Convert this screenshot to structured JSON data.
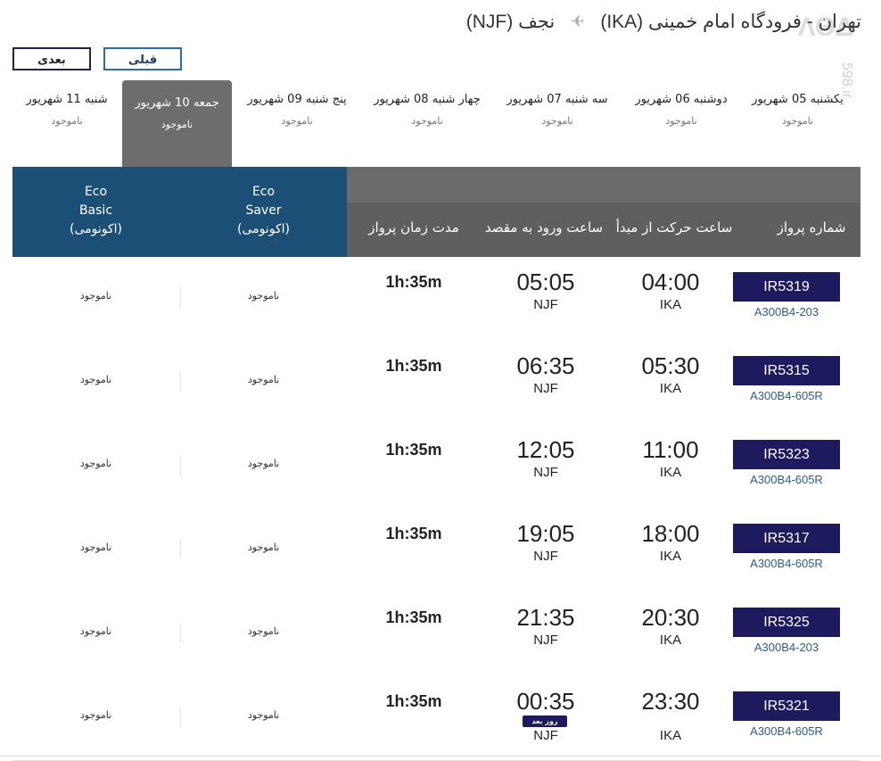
{
  "route": {
    "origin": "تهران - فرودگاه امام خمینی (IKA)",
    "destination": "نجف (NJF)",
    "plane_icon": "✈"
  },
  "watermark": {
    "main": "ΛΘΔ",
    "vertical": "598.ir"
  },
  "nav": {
    "prev_label": "قبلی",
    "next_label": "بعدی"
  },
  "days": [
    {
      "label": "یکشنبه 05 شهریور",
      "status": "ناموجود",
      "active": false
    },
    {
      "label": "دوشنبه 06 شهریور",
      "status": "ناموجود",
      "active": false
    },
    {
      "label": "سه شنبه 07 شهریور",
      "status": "ناموجود",
      "active": false
    },
    {
      "label": "چهار شنبه 08 شهریور",
      "status": "ناموجود",
      "active": false
    },
    {
      "label": "پنج شنبه 09 شهریور",
      "status": "ناموجود",
      "active": false
    },
    {
      "label": "جمعه 10 شهریور",
      "status": "ناموجود",
      "active": true
    },
    {
      "label": "شنبه 11 شهریور",
      "status": "ناموجود",
      "active": false
    }
  ],
  "columns": {
    "flight_no": "شماره پرواز",
    "departure": "ساعت حرکت از مبدأ",
    "arrival": "ساعت ورود به مقصد",
    "duration": "مدت زمان پرواز",
    "fare_saver": "Eco\nSaver\n(اکونومی)",
    "fare_basic": "Eco\nBasic\n(اکونومی)"
  },
  "next_day_badge": "روز بعد",
  "flights": [
    {
      "flight_no": "IR5319",
      "aircraft": "A300B4-203",
      "dep_time": "04:00",
      "dep_code": "IKA",
      "arr_time": "05:05",
      "arr_code": "NJF",
      "duration": "1h:35m",
      "saver": "ناموجود",
      "basic": "ناموجود",
      "next_day": false
    },
    {
      "flight_no": "IR5315",
      "aircraft": "A300B4-605R",
      "dep_time": "05:30",
      "dep_code": "IKA",
      "arr_time": "06:35",
      "arr_code": "NJF",
      "duration": "1h:35m",
      "saver": "ناموجود",
      "basic": "ناموجود",
      "next_day": false
    },
    {
      "flight_no": "IR5323",
      "aircraft": "A300B4-605R",
      "dep_time": "11:00",
      "dep_code": "IKA",
      "arr_time": "12:05",
      "arr_code": "NJF",
      "duration": "1h:35m",
      "saver": "ناموجود",
      "basic": "ناموجود",
      "next_day": false
    },
    {
      "flight_no": "IR5317",
      "aircraft": "A300B4-605R",
      "dep_time": "18:00",
      "dep_code": "IKA",
      "arr_time": "19:05",
      "arr_code": "NJF",
      "duration": "1h:35m",
      "saver": "ناموجود",
      "basic": "ناموجود",
      "next_day": false
    },
    {
      "flight_no": "IR5325",
      "aircraft": "A300B4-203",
      "dep_time": "20:30",
      "dep_code": "IKA",
      "arr_time": "21:35",
      "arr_code": "NJF",
      "duration": "1h:35m",
      "saver": "ناموجود",
      "basic": "ناموجود",
      "next_day": false
    },
    {
      "flight_no": "IR5321",
      "aircraft": "A300B4-605R",
      "dep_time": "23:30",
      "dep_code": "IKA",
      "arr_time": "00:35",
      "arr_code": "NJF",
      "duration": "1h:35m",
      "saver": "ناموجود",
      "basic": "ناموجود",
      "next_day": true
    }
  ],
  "colors": {
    "flight_badge": "#1e1a5e",
    "fare_header": "#1c4f76",
    "table_header": "#5f5f5f",
    "active_day": "#6d6d6d",
    "aircraft_link": "#2a5d8f"
  }
}
